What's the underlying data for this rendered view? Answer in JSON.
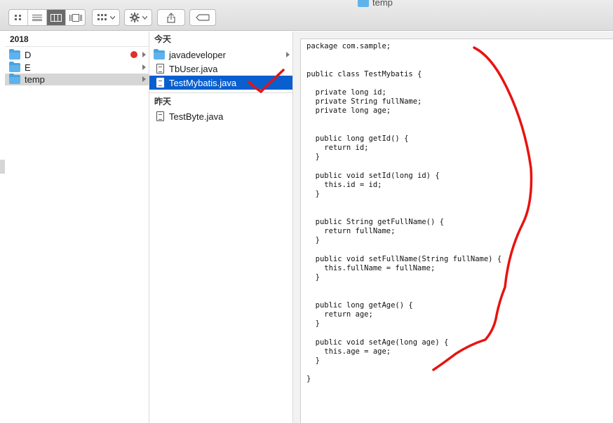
{
  "window": {
    "title": "temp"
  },
  "toolbar": {
    "view_icons": [
      "icon-view-icon",
      "list-view-icon",
      "column-view-icon",
      "gallery-view-icon"
    ],
    "arrange_icon": "arrange-grid-icon",
    "action_icon": "gear-icon",
    "share_icon": "share-icon",
    "tag_icon": "tag-icon"
  },
  "columns": {
    "first": {
      "header": "2018",
      "items": [
        {
          "label": "D",
          "tag_color": "#e0302a"
        },
        {
          "label": "E"
        },
        {
          "label": "temp"
        }
      ]
    },
    "second": {
      "group_today": "今天",
      "group_yesterday": "昨天",
      "today_items": [
        {
          "label": "javadeveloper"
        },
        {
          "label": "TbUser.java"
        },
        {
          "label": "TestMybatis.java"
        }
      ],
      "yesterday_items": [
        {
          "label": "TestByte.java"
        }
      ]
    }
  },
  "preview": {
    "code": "package com.sample;\n\n\npublic class TestMybatis {\n\n  private long id;\n  private String fullName;\n  private long age;\n\n\n  public long getId() {\n    return id;\n  }\n\n  public void setId(long id) {\n    this.id = id;\n  }\n\n\n  public String getFullName() {\n    return fullName;\n  }\n\n  public void setFullName(String fullName) {\n    this.fullName = fullName;\n  }\n\n\n  public long getAge() {\n    return age;\n  }\n\n  public void setAge(long age) {\n    this.age = age;\n  }\n\n}"
  },
  "colors": {
    "selection_blue": "#0a5fcf",
    "annotation_red": "#e8130f",
    "folder_blue": "#5fb3ec"
  }
}
